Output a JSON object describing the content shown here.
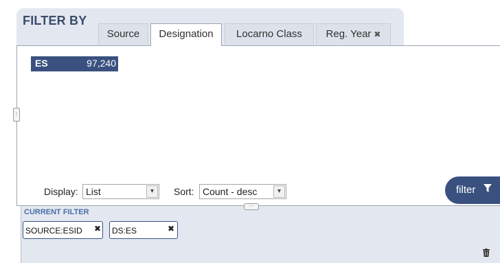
{
  "panel": {
    "title": "FILTER BY"
  },
  "tabs": [
    {
      "label": "Source",
      "active": false
    },
    {
      "label": "Designation",
      "active": true
    },
    {
      "label": "Locarno Class",
      "active": false
    },
    {
      "label": "Reg. Year",
      "active": false,
      "close_icon": "✖"
    }
  ],
  "results": [
    {
      "code": "ES",
      "count": "97,240",
      "selected": true
    }
  ],
  "controls": {
    "display_label": "Display:",
    "display_value": "List",
    "sort_label": "Sort:",
    "sort_value": "Count - desc",
    "filter_button_label": "filter",
    "filter_icon": "funnel-icon"
  },
  "current_filter": {
    "title": "CURRENT FILTER",
    "chips": [
      {
        "label": "SOURCE:ESID",
        "close": "✖"
      },
      {
        "label": "DS:ES",
        "close": "✖"
      }
    ],
    "clear_icon": "trash-icon"
  },
  "colors": {
    "accent": "#3a5180",
    "panel_bg": "#e3e8f0",
    "title_text": "#3b4d6b",
    "current_filter_title": "#4a6ea9"
  }
}
